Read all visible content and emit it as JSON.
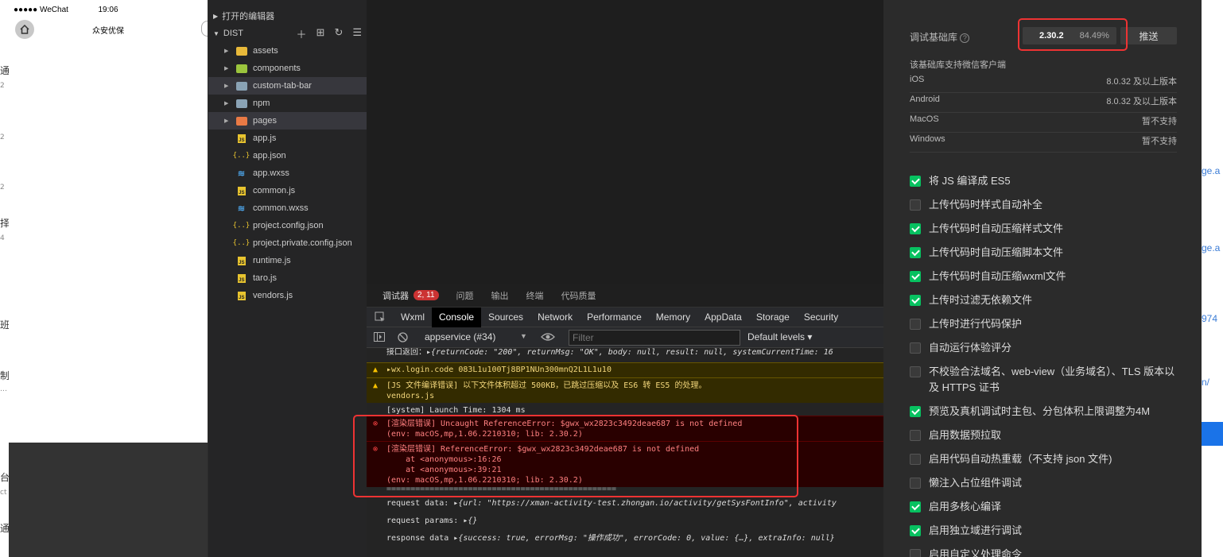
{
  "left_strip": {
    "chars": [
      "通",
      "2",
      "2",
      "2",
      "择",
      "4",
      "班",
      "制",
      "…",
      "台",
      "ct",
      "通"
    ]
  },
  "phone": {
    "carrier": "●●●●● WeChat",
    "time": "19:06",
    "title": "众安优保"
  },
  "explorer": {
    "open_editors_label": "打开的编辑器",
    "root_label": "DIST",
    "items": [
      {
        "name": "assets",
        "kind": "folder",
        "color": "#e8b93a"
      },
      {
        "name": "components",
        "kind": "folder",
        "color": "#9bc53d"
      },
      {
        "name": "custom-tab-bar",
        "kind": "folder",
        "color": "#8aa3b5"
      },
      {
        "name": "npm",
        "kind": "folder",
        "color": "#8aa3b5"
      },
      {
        "name": "pages",
        "kind": "folder",
        "color": "#e97a45"
      },
      {
        "name": "app.js",
        "kind": "js"
      },
      {
        "name": "app.json",
        "kind": "json"
      },
      {
        "name": "app.wxss",
        "kind": "css"
      },
      {
        "name": "common.js",
        "kind": "js"
      },
      {
        "name": "common.wxss",
        "kind": "css"
      },
      {
        "name": "project.config.json",
        "kind": "json"
      },
      {
        "name": "project.private.config.json",
        "kind": "json"
      },
      {
        "name": "runtime.js",
        "kind": "js"
      },
      {
        "name": "taro.js",
        "kind": "js"
      },
      {
        "name": "vendors.js",
        "kind": "js"
      }
    ]
  },
  "devtools": {
    "top_tabs": {
      "debugger": "调试器",
      "badge": "2, 11",
      "issues": "问题",
      "output": "输出",
      "terminal": "终端",
      "code_quality": "代码质量"
    },
    "panel_tabs": [
      "Wxml",
      "Console",
      "Sources",
      "Network",
      "Performance",
      "Memory",
      "AppData",
      "Storage",
      "Security"
    ],
    "active_panel": "Console",
    "context": "appservice (#34)",
    "filter_placeholder": "Filter",
    "levels": "Default levels ▾",
    "console": {
      "l1_label": "接口返回：",
      "l1_obj": "{returnCode: \"200\", returnMsg: \"OK\", body: null, result: null, systemCurrentTime: 16",
      "l2": "wx.login.code 083L1u100Tj8BP1NUn300mnQ2L1L1u10",
      "l3a": "[JS 文件编译错误] 以下文件体积超过 500KB，已跳过压缩以及 ES6 转 ES5 的处理。",
      "l3b": "vendors.js",
      "l4": "[system] Launch Time: 1304 ms",
      "e1a": "[渲染层错误] Uncaught ReferenceError: $gwx_wx2823c3492deae687 is not defined",
      "e1b": "(env: macOS,mp,1.06.2210310; lib: 2.30.2)",
      "e2a": "[渲染层错误] ReferenceError: $gwx_wx2823c3492deae687 is not defined",
      "e2b": "    at <anonymous>:16:26",
      "e2c": "    at <anonymous>:39:21",
      "e2d": "(env: macOS,mp,1.06.2210310; lib: 2.30.2)",
      "sep": "================================================",
      "req_data_label": "request data: ",
      "req_data": "{url: \"https://xman-activity-test.zhongan.io/activity/getSysFontInfo\", activity",
      "req_params_label": "request params: ",
      "req_params": "{}",
      "resp_label": "response data ",
      "resp": "{success: true, errorMsg: \"操作成功\", errorCode: 0, value: {…}, extraInfo: null}"
    }
  },
  "settings": {
    "lib_label": "调试基础库",
    "lib_version": "2.30.2",
    "lib_percent": "84.49%",
    "push": "推送",
    "support_title": "该基础库支持微信客户端",
    "platforms": [
      {
        "name": "iOS",
        "value": "8.0.32 及以上版本"
      },
      {
        "name": "Android",
        "value": "8.0.32 及以上版本"
      },
      {
        "name": "MacOS",
        "value": "暂不支持"
      },
      {
        "name": "Windows",
        "value": "暂不支持"
      }
    ],
    "options": [
      {
        "label": "将 JS 编译成 ES5",
        "checked": true
      },
      {
        "label": "上传代码时样式自动补全",
        "checked": false
      },
      {
        "label": "上传代码时自动压缩样式文件",
        "checked": true
      },
      {
        "label": "上传代码时自动压缩脚本文件",
        "checked": true
      },
      {
        "label": "上传代码时自动压缩wxml文件",
        "checked": true
      },
      {
        "label": "上传时过滤无依赖文件",
        "checked": true
      },
      {
        "label": "上传时进行代码保护",
        "checked": false
      },
      {
        "label": "自动运行体验评分",
        "checked": false
      },
      {
        "label": "不校验合法域名、web-view（业务域名）、TLS 版本以及 HTTPS 证书",
        "checked": false
      },
      {
        "label": "预览及真机调试时主包、分包体积上限调整为4M",
        "checked": true
      },
      {
        "label": "启用数据预拉取",
        "checked": false
      },
      {
        "label": "启用代码自动热重载（不支持 json 文件)",
        "checked": false
      },
      {
        "label": "懒注入占位组件调试",
        "checked": false
      },
      {
        "label": "启用多核心编译",
        "checked": true
      },
      {
        "label": "启用独立域进行调试",
        "checked": true
      },
      {
        "label": "启用自定义处理命令",
        "checked": false
      }
    ]
  },
  "far_right": {
    "fragments": [
      "ge.a",
      "ge.a",
      "974",
      "n/"
    ]
  }
}
